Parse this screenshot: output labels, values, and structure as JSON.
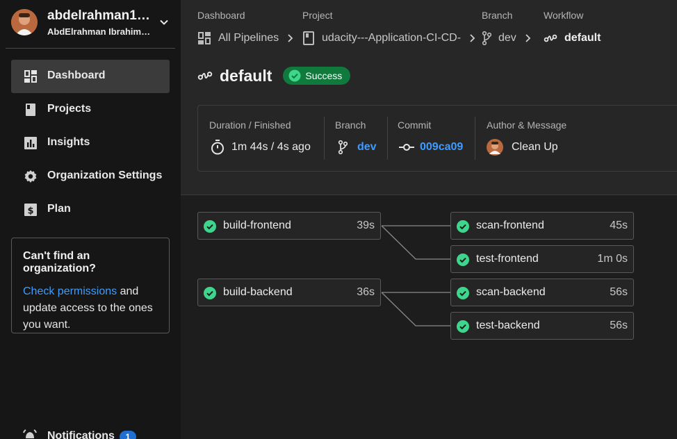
{
  "user": {
    "username": "abdelrahman1…",
    "full_name": "AbdElrahman Ibrahim…"
  },
  "sidebar": {
    "items": [
      {
        "label": "Dashboard",
        "icon": "dashboard-icon",
        "active": true
      },
      {
        "label": "Projects",
        "icon": "projects-icon",
        "active": false
      },
      {
        "label": "Insights",
        "icon": "insights-icon",
        "active": false
      },
      {
        "label": "Organization Settings",
        "icon": "gear-icon",
        "active": false
      },
      {
        "label": "Plan",
        "icon": "plan-icon",
        "active": false
      }
    ],
    "org_box": {
      "title": "Can't find an organization?",
      "link": "Check permissions",
      "text": " and update access to the ones you want."
    },
    "notifications": {
      "label": "Notifications",
      "count": "1"
    }
  },
  "breadcrumbs": [
    {
      "label": "Dashboard",
      "value": "All Pipelines",
      "icon": "pipelines-icon"
    },
    {
      "label": "Project",
      "value": "udacity---Application-CI-CD-",
      "icon": "project-book-icon"
    },
    {
      "label": "Branch",
      "value": "dev",
      "icon": "branch-icon"
    },
    {
      "label": "Workflow",
      "value": "default",
      "icon": "workflow-icon"
    }
  ],
  "workflow": {
    "name": "default",
    "status": "Success"
  },
  "info": {
    "duration_label": "Duration / Finished",
    "duration_value": "1m 44s / 4s ago",
    "branch_label": "Branch",
    "branch_value": "dev",
    "commit_label": "Commit",
    "commit_value": "009ca09",
    "author_label": "Author & Message",
    "author_message": "Clean Up"
  },
  "jobs": [
    {
      "name": "build-frontend",
      "duration": "39s"
    },
    {
      "name": "scan-frontend",
      "duration": "45s"
    },
    {
      "name": "test-frontend",
      "duration": "1m 0s"
    },
    {
      "name": "build-backend",
      "duration": "36s"
    },
    {
      "name": "scan-backend",
      "duration": "56s"
    },
    {
      "name": "test-backend",
      "duration": "56s"
    }
  ],
  "colors": {
    "success": "#3dd68c",
    "link": "#3e9cff",
    "status_bg": "#0f7a3b"
  }
}
